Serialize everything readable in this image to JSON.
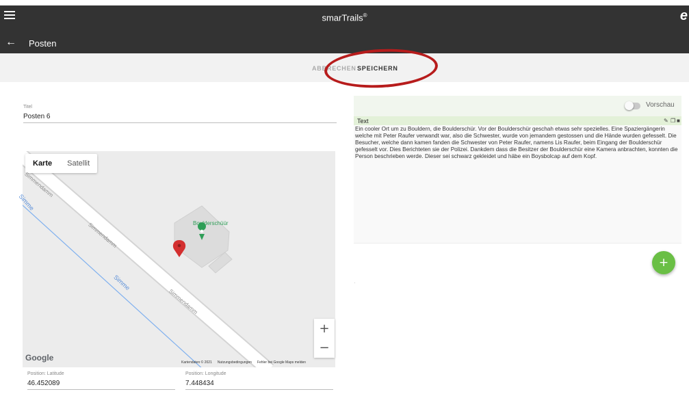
{
  "app": {
    "title": "smarTrails",
    "trademark": "®",
    "user_glyph": "e"
  },
  "header": {
    "page_title": "Posten"
  },
  "actions": {
    "cancel_label": "ABBRECHEN",
    "save_label": "SPEICHERN"
  },
  "form": {
    "title_label": "Titel",
    "title_value": "Posten 6",
    "latitude_label": "Position: Latitude",
    "latitude_value": "46.452089",
    "longitude_label": "Position: Longitude",
    "longitude_value": "7.448434"
  },
  "map": {
    "tabs": [
      {
        "label": "Karte",
        "active": true
      },
      {
        "label": "Satellit",
        "active": false
      }
    ],
    "poi_name": "Boulderschüür",
    "road_name": "Simmendamm",
    "river_name": "Simme",
    "zoom_in": "+",
    "zoom_out": "−",
    "logo": "Google",
    "attribution": [
      "Kartendaten © 2021",
      "Nutzungsbedingungen",
      "Fehler bei Google Maps melden"
    ]
  },
  "panel": {
    "preview_label": "Vorschau",
    "card_title": "Text",
    "card_body": "Ein cooler Ort um zu Bouldern, die Boulderschür. Vor der Boulderschür geschah etwas sehr spezielles. Eine Spaziergängerin welche mit Peter Raufer verwandt war, also die Schwester, wurde von jemandem gestossen und die Hände wurden gefesselt. Die Besucher, welche dann kamen fanden die Schwester von Peter Raufer, namens Lis Raufer, beim Eingang der Boulderschür gefesselt vor. Dies Berichteten sie der Polizei. Dankdem dass die Besitzer der Boulderschür eine Kamera anbrachten, konnten die Person beschrieben werde. Dieser sei schwarz gekleidet und häbe ein Boysbolcap auf dem Kopf.",
    "add_label": "+"
  },
  "colors": {
    "topbar": "#333333",
    "accent_green": "#6abf45",
    "annotation_red": "#b71c1c",
    "marker_red": "#d32f2f",
    "poi_green": "#2e9e57"
  }
}
